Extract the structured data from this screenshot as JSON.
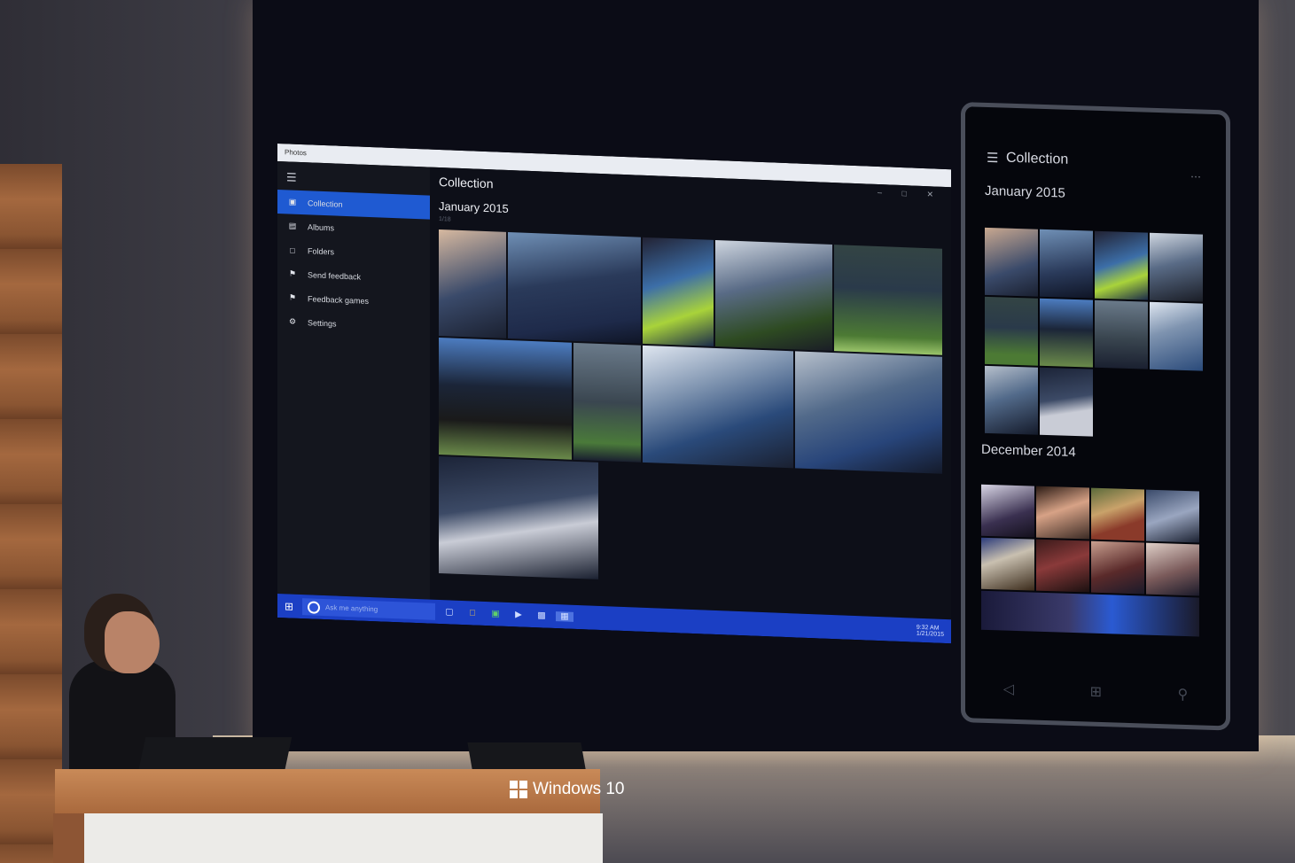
{
  "desktop_app": {
    "window_title": "Photos",
    "menu_icon": "hamburger-icon",
    "nav_items": [
      {
        "label": "Collection",
        "icon": "collection-icon",
        "glyph": "▣",
        "active": true
      },
      {
        "label": "Albums",
        "icon": "albums-icon",
        "glyph": "▤",
        "active": false
      },
      {
        "label": "Folders",
        "icon": "folder-icon",
        "glyph": "□",
        "active": false
      },
      {
        "label": "Send feedback",
        "icon": "feedback-icon",
        "glyph": "⚑",
        "active": false
      },
      {
        "label": "Feedback games",
        "icon": "games-icon",
        "glyph": "⚑",
        "active": false
      },
      {
        "label": "Settings",
        "icon": "gear-icon",
        "glyph": "⚙",
        "active": false
      }
    ],
    "main_title": "Collection",
    "window_controls": "– □ ✕",
    "month": "January 2015",
    "month_sub": "1/18",
    "taskbar": {
      "search_placeholder": "Ask me anything",
      "tray_time": "9:32 AM",
      "tray_date": "1/21/2015"
    }
  },
  "phone_app": {
    "title": "Collection",
    "month_1": "January 2015",
    "month_2": "December 2014"
  },
  "podium": {
    "brand": "Windows 10"
  },
  "colors": {
    "accent": "#1f5ad2",
    "taskbar": "#1b3fc4",
    "app_bg": "#0d0f18"
  }
}
